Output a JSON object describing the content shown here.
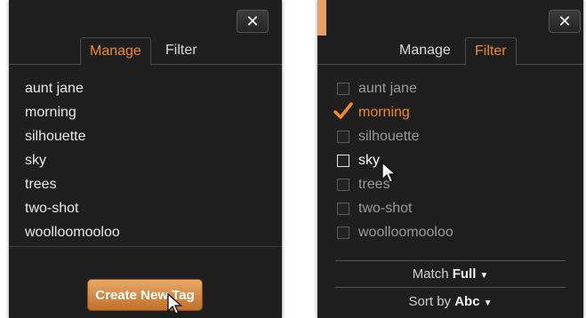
{
  "colors": {
    "panel_bg": "#1f1f1f",
    "accent_orange": "#f08a24",
    "button_orange": "#c06f2a"
  },
  "left_panel": {
    "close_label": "✕",
    "tabs": [
      {
        "label": "Manage",
        "active": true
      },
      {
        "label": "Filter",
        "active": false
      }
    ],
    "tags": [
      "aunt jane",
      "morning",
      "silhouette",
      "sky",
      "trees",
      "two-shot",
      "woolloomooloo"
    ],
    "create_button_label": "Create New Tag"
  },
  "right_panel": {
    "close_label": "✕",
    "tabs": [
      {
        "label": "Manage",
        "active": false
      },
      {
        "label": "Filter",
        "active": true
      }
    ],
    "tags": [
      {
        "label": "aunt jane",
        "checked": false
      },
      {
        "label": "morning",
        "checked": true
      },
      {
        "label": "silhouette",
        "checked": false
      },
      {
        "label": "sky",
        "checked": false,
        "hovered": true
      },
      {
        "label": "trees",
        "checked": false
      },
      {
        "label": "two-shot",
        "checked": false
      },
      {
        "label": "woolloomooloo",
        "checked": false
      }
    ],
    "match": {
      "label": "Match",
      "value": "Full"
    },
    "sort": {
      "label": "Sort by",
      "value": "Abc"
    }
  },
  "icons": {
    "close": "close-icon",
    "checkmark": "checkmark-icon",
    "caret": "caret-down-icon",
    "cursor": "mouse-pointer-icon"
  }
}
